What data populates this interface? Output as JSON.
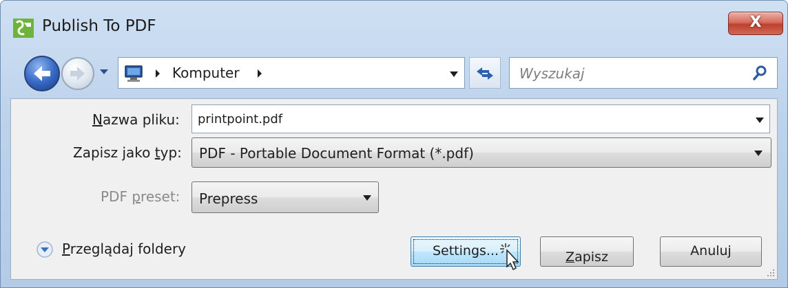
{
  "window": {
    "title": "Publish To PDF",
    "close_label": "X",
    "accent": "#3a6bc7",
    "close_color": "#c0402f"
  },
  "nav": {
    "back_icon": "back-arrow-icon",
    "forward_icon": "forward-arrow-icon",
    "address": {
      "location": "Komputer",
      "icon": "computer-icon"
    },
    "refresh_icon": "refresh-icon",
    "search": {
      "placeholder": "Wyszukaj",
      "icon": "search-icon"
    }
  },
  "form": {
    "filename": {
      "label_key": "N",
      "label_rest": "azwa pliku:",
      "value": "printpoint.pdf"
    },
    "filetype": {
      "label_pre": "Zapisz jako ",
      "label_key": "t",
      "label_post": "yp:",
      "value": "PDF - Portable Document Format (*.pdf)"
    },
    "preset": {
      "label_pre": "PDF ",
      "label_key": "p",
      "label_post": "reset:",
      "value": "Prepress"
    }
  },
  "footer": {
    "browse_key": "P",
    "browse_rest": "rzeglądaj foldery",
    "settings_label": "Settings...",
    "save_key": "Z",
    "save_rest": "apisz",
    "cancel_label": "Anuluj"
  }
}
